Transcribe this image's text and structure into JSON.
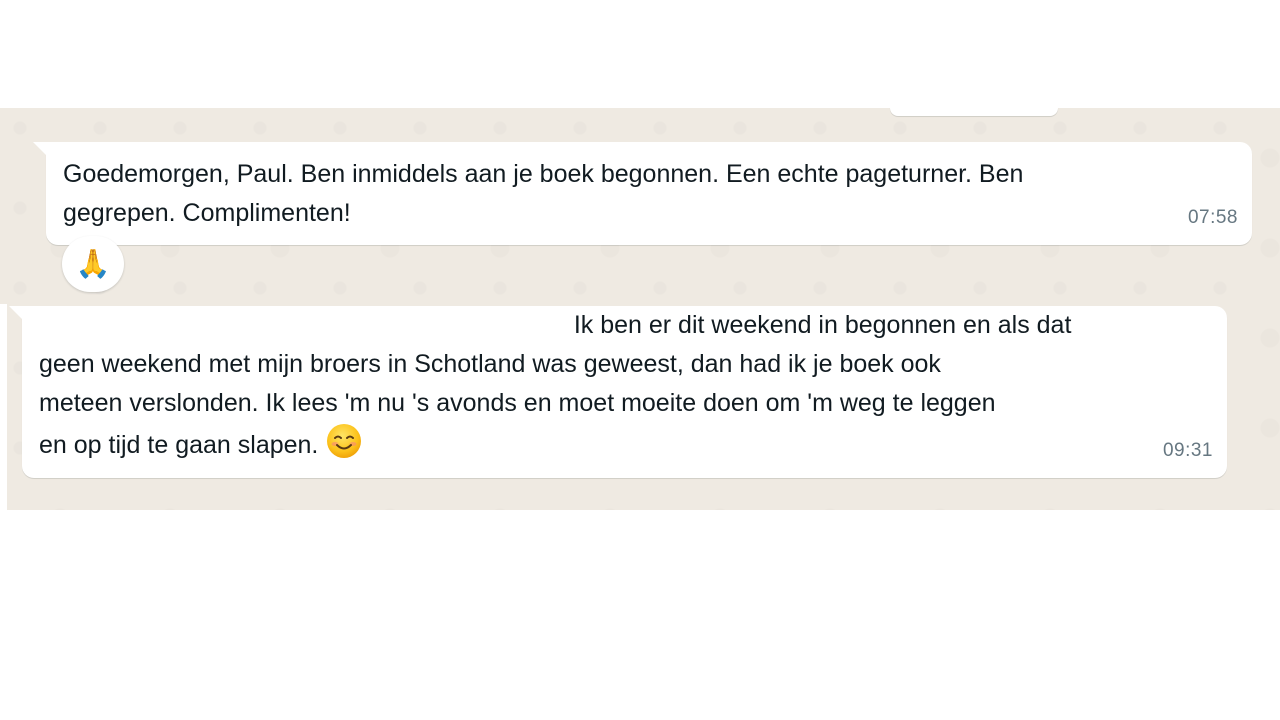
{
  "messages": [
    {
      "text": "Goedemorgen, Paul. Ben inmiddels aan je boek begonnen. Een echte pageturner. Ben\ngegrepen. Complimenten!",
      "time": "07:58",
      "reaction": "🙏",
      "reaction_icon": "folded-hands-icon"
    },
    {
      "text": "                                                                             Ik ben er dit weekend in begonnen en als dat\ngeen weekend met mijn broers in Schotland was geweest, dan had ik je boek ook\nmeteen verslonden. Ik lees 'm nu 's avonds en moet moeite doen om 'm weg te leggen\nen op tijd te gaan slapen.",
      "trailing_emoji_icon": "smiling-face-icon",
      "time": "09:31"
    }
  ],
  "colors": {
    "chat_background": "#efeae2",
    "bubble": "#ffffff",
    "text": "#111b21",
    "timestamp": "#667781"
  }
}
